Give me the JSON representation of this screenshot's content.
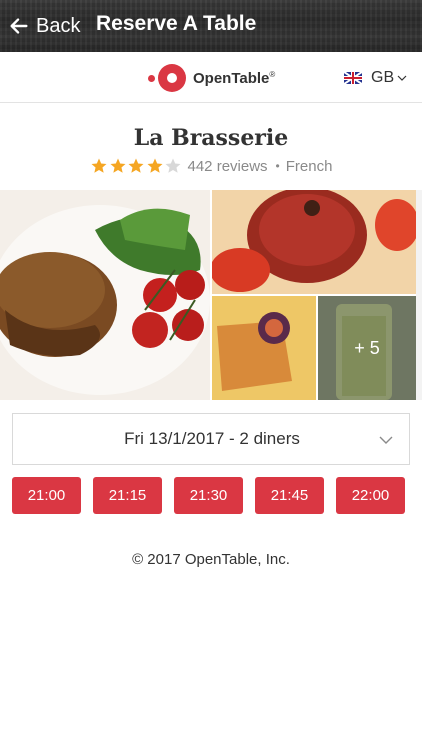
{
  "header": {
    "back_label": "Back",
    "title": "Reserve A Table"
  },
  "brand": {
    "name": "OpenTable",
    "reg": "®",
    "accent": "#da3743"
  },
  "locale": {
    "code": "GB",
    "flag": "uk-flag-icon"
  },
  "restaurant": {
    "name": "La Brasserie",
    "rating": 4,
    "rating_max": 5,
    "reviews": "442 reviews",
    "separator": "•",
    "cuisine": "French"
  },
  "photos": {
    "more_label": "+ 5"
  },
  "booking": {
    "date_party": "Fri 13/1/2017 - 2 diners",
    "times": [
      "21:00",
      "21:15",
      "21:30",
      "21:45",
      "22:00"
    ]
  },
  "footer": {
    "copyright": "© 2017 OpenTable, Inc."
  },
  "colors": {
    "star_filled": "#f5a623",
    "star_empty": "#d8d8d8",
    "slot_bg": "#da3743"
  }
}
